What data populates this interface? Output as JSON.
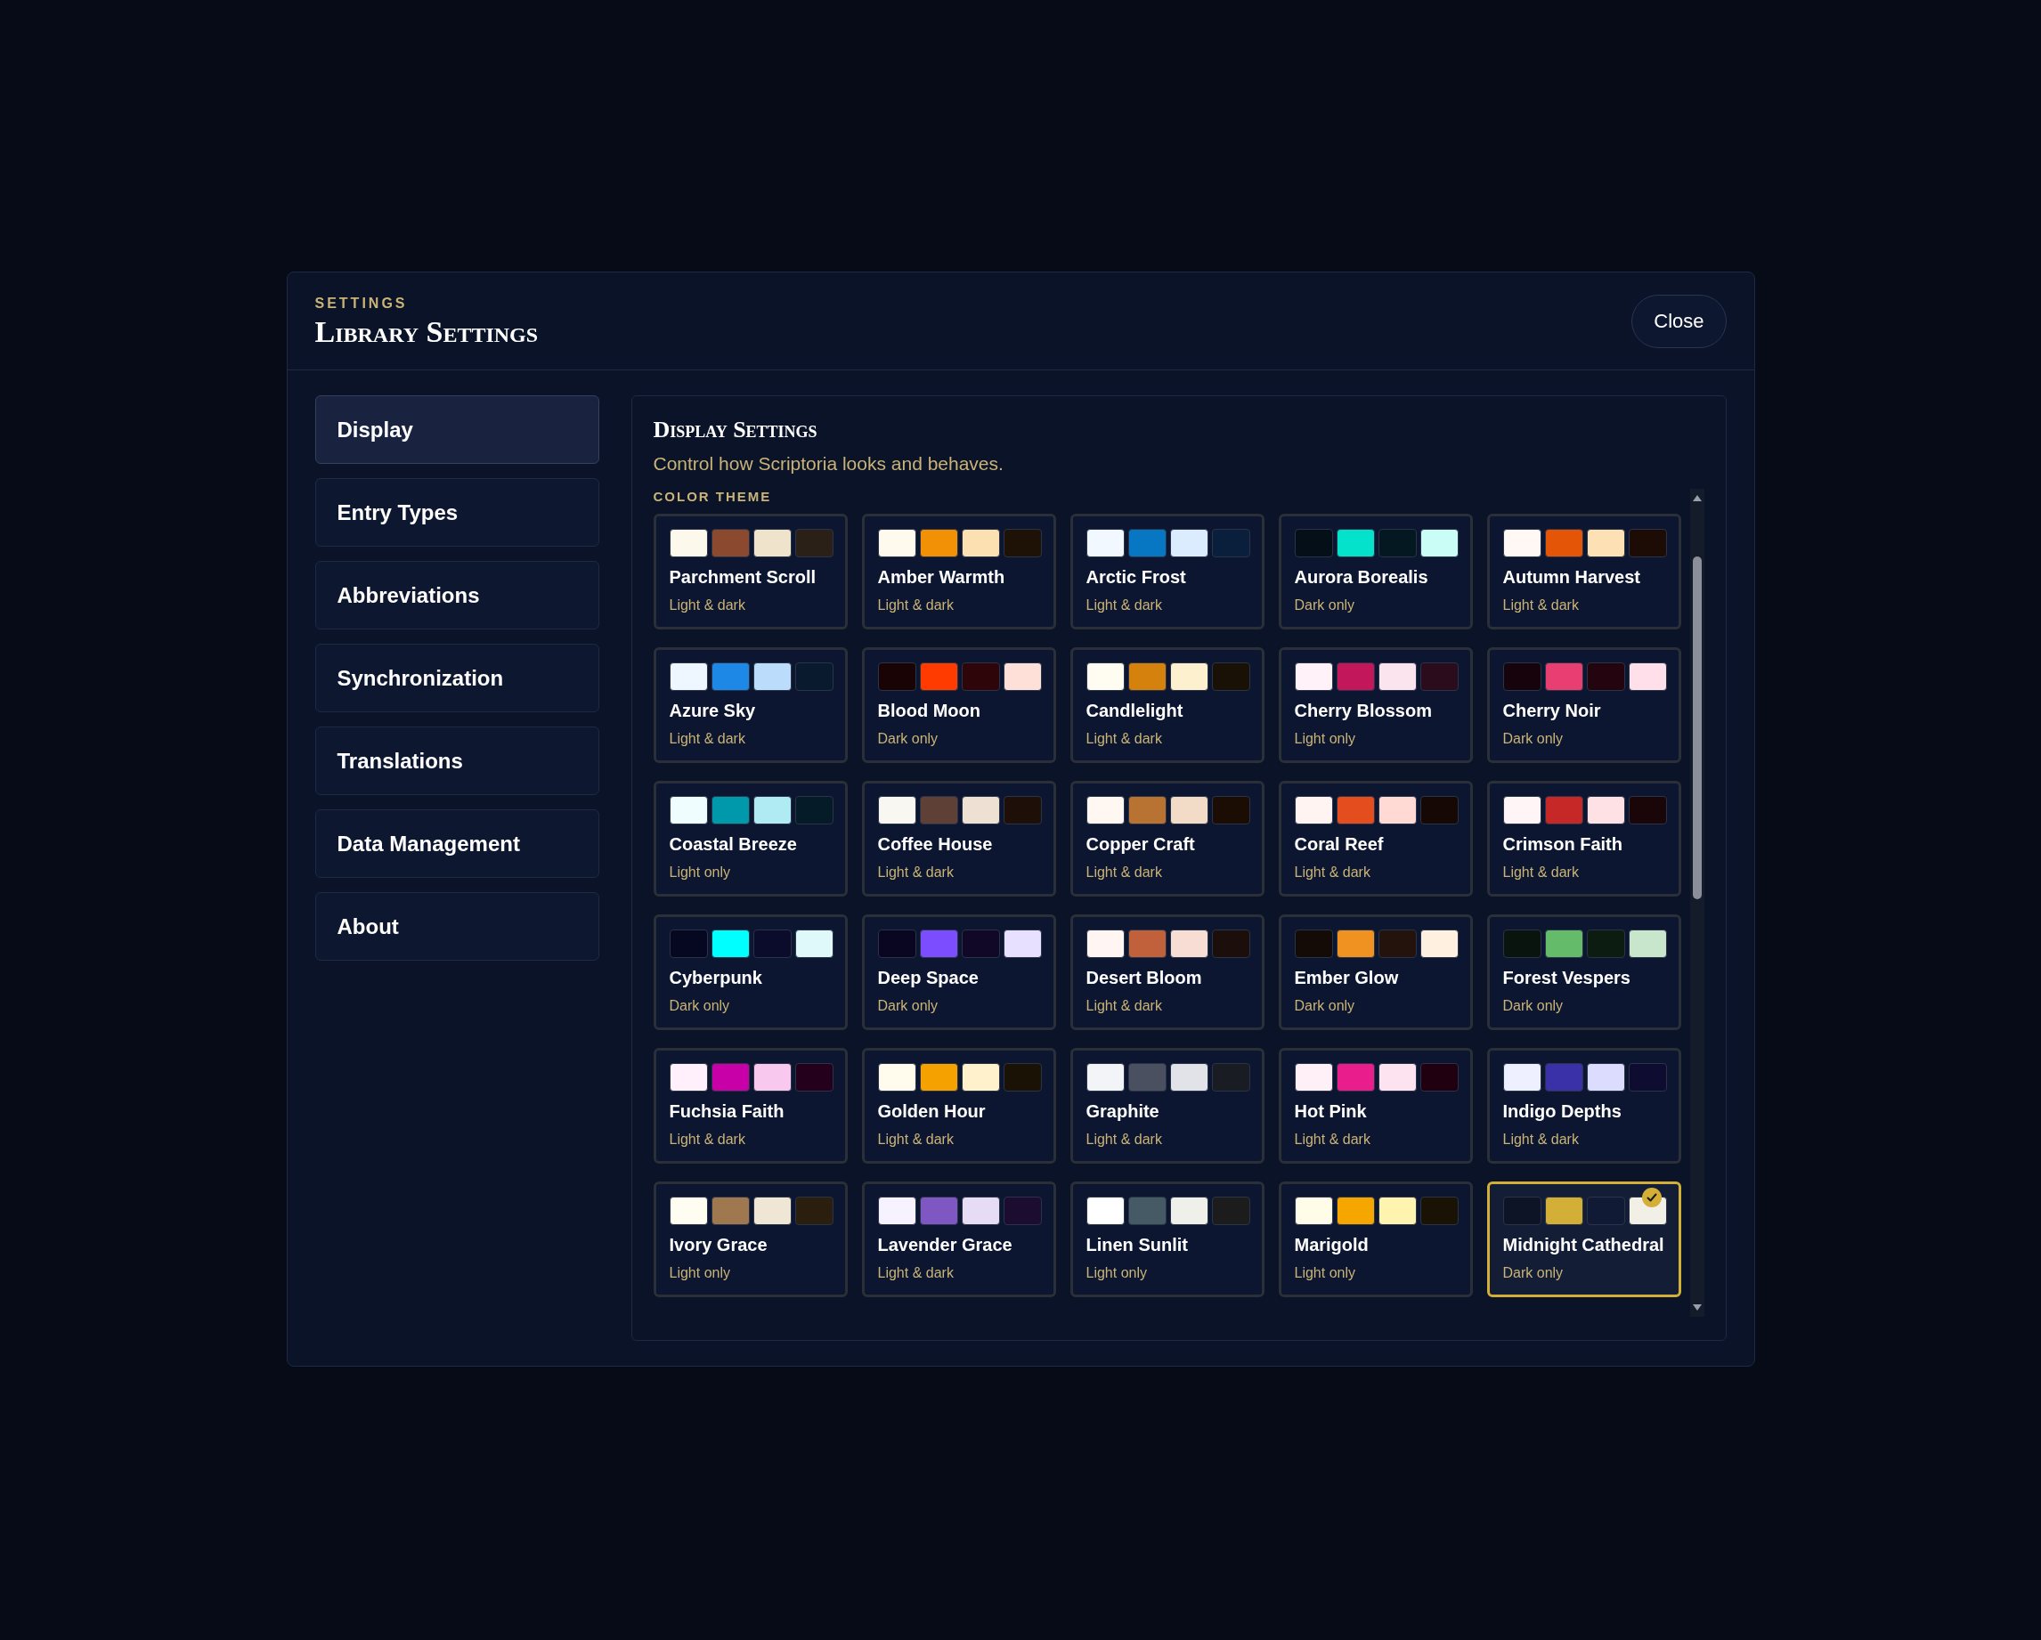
{
  "dialog": {
    "eyebrow": "SETTINGS",
    "title": "Library Settings",
    "close_label": "Close"
  },
  "sidebar": {
    "items": [
      {
        "label": "Display",
        "selected": true
      },
      {
        "label": "Entry Types",
        "selected": false
      },
      {
        "label": "Abbreviations",
        "selected": false
      },
      {
        "label": "Synchronization",
        "selected": false
      },
      {
        "label": "Translations",
        "selected": false
      },
      {
        "label": "Data Management",
        "selected": false
      },
      {
        "label": "About",
        "selected": false
      }
    ]
  },
  "panel": {
    "title": "Display Settings",
    "subtitle": "Control how Scriptoria looks and behaves.",
    "section_label": "COLOR THEME"
  },
  "themes": [
    {
      "name": "Parchment Scroll",
      "mode": "Light & dark",
      "selected": false,
      "swatches": [
        {
          "color": "#fdf8ec"
        },
        {
          "color": "#8b4a30"
        },
        {
          "color": "#f0e3cc"
        },
        {
          "color": "#2a2018"
        }
      ]
    },
    {
      "name": "Amber Warmth",
      "mode": "Light & dark",
      "selected": false,
      "swatches": [
        {
          "color": "#fffaee"
        },
        {
          "color": "#f29105"
        },
        {
          "color": "#fde0b2"
        },
        {
          "color": "#1e1206"
        }
      ]
    },
    {
      "name": "Arctic Frost",
      "mode": "Light & dark",
      "selected": false,
      "swatches": [
        {
          "color": "#f2f8ff"
        },
        {
          "color": "#0777c4"
        },
        {
          "color": "#dcecff"
        },
        {
          "color": "#0a1f3c"
        }
      ]
    },
    {
      "name": "Aurora Borealis",
      "mode": "Dark only",
      "selected": false,
      "swatches": [
        {
          "color": "#040f18"
        },
        {
          "color": "#05e2cb"
        },
        {
          "color": "#041822"
        },
        {
          "color": "#c9fdf5"
        }
      ]
    },
    {
      "name": "Autumn Harvest",
      "mode": "Light & dark",
      "selected": false,
      "swatches": [
        {
          "color": "#fff8f4"
        },
        {
          "color": "#e45508"
        },
        {
          "color": "#fde0b4"
        },
        {
          "color": "#1d0c06"
        }
      ]
    },
    {
      "name": "Azure Sky",
      "mode": "Light & dark",
      "selected": false,
      "swatches": [
        {
          "color": "#eef6ff"
        },
        {
          "color": "#1d88e5"
        },
        {
          "color": "#bcdcfb"
        },
        {
          "color": "#0a1a2e"
        }
      ]
    },
    {
      "name": "Blood Moon",
      "mode": "Dark only",
      "selected": false,
      "swatches": [
        {
          "color": "#1a0305"
        },
        {
          "color": "#ff3b00"
        },
        {
          "color": "#2e0508"
        },
        {
          "color": "#ffe0d9"
        }
      ]
    },
    {
      "name": "Candlelight",
      "mode": "Light & dark",
      "selected": false,
      "swatches": [
        {
          "color": "#fffdf2"
        },
        {
          "color": "#d4820d"
        },
        {
          "color": "#fdf0cf"
        },
        {
          "color": "#1a1106"
        }
      ]
    },
    {
      "name": "Cherry Blossom",
      "mode": "Light only",
      "selected": false,
      "swatches": [
        {
          "color": "#fff2f8"
        },
        {
          "color": "#c2185b"
        },
        {
          "color": "#fce4ee"
        },
        {
          "color": "#2a0c1c"
        }
      ]
    },
    {
      "name": "Cherry Noir",
      "mode": "Dark only",
      "selected": false,
      "swatches": [
        {
          "color": "#16030c"
        },
        {
          "color": "#e83e72"
        },
        {
          "color": "#24040f"
        },
        {
          "color": "#ffdfe9"
        }
      ]
    },
    {
      "name": "Coastal Breeze",
      "mode": "Light only",
      "selected": false,
      "swatches": [
        {
          "color": "#effdff"
        },
        {
          "color": "#0098ab"
        },
        {
          "color": "#b0ebf3"
        },
        {
          "color": "#051b28"
        }
      ]
    },
    {
      "name": "Coffee House",
      "mode": "Light & dark",
      "selected": false,
      "swatches": [
        {
          "color": "#f8f7f2"
        },
        {
          "color": "#5e4037"
        },
        {
          "color": "#eee0d3"
        },
        {
          "color": "#1e0f08"
        }
      ]
    },
    {
      "name": "Copper Craft",
      "mode": "Light & dark",
      "selected": false,
      "swatches": [
        {
          "color": "#fff7f2"
        },
        {
          "color": "#b87333"
        },
        {
          "color": "#f2dcc7"
        },
        {
          "color": "#1c0d04"
        }
      ]
    },
    {
      "name": "Coral Reef",
      "mode": "Light & dark",
      "selected": false,
      "swatches": [
        {
          "color": "#fff4f2"
        },
        {
          "color": "#e44d1d"
        },
        {
          "color": "#ffdad4"
        },
        {
          "color": "#160804"
        }
      ]
    },
    {
      "name": "Crimson Faith",
      "mode": "Light & dark",
      "selected": false,
      "swatches": [
        {
          "color": "#fff4f6"
        },
        {
          "color": "#c62828"
        },
        {
          "color": "#fde1e5"
        },
        {
          "color": "#1a0508"
        }
      ]
    },
    {
      "name": "Cyberpunk",
      "mode": "Dark only",
      "selected": false,
      "swatches": [
        {
          "color": "#060720"
        },
        {
          "color": "#00ffff"
        },
        {
          "color": "#0b0b2c"
        },
        {
          "color": "#dff8fa"
        }
      ]
    },
    {
      "name": "Deep Space",
      "mode": "Dark only",
      "selected": false,
      "swatches": [
        {
          "color": "#0a0520"
        },
        {
          "color": "#7c4dff"
        },
        {
          "color": "#100826"
        },
        {
          "color": "#e8e0ff"
        }
      ]
    },
    {
      "name": "Desert Bloom",
      "mode": "Light & dark",
      "selected": false,
      "swatches": [
        {
          "color": "#fff5f2"
        },
        {
          "color": "#c0613b"
        },
        {
          "color": "#f8ddd4"
        },
        {
          "color": "#1c0e0a"
        }
      ]
    },
    {
      "name": "Ember Glow",
      "mode": "Dark only",
      "selected": false,
      "swatches": [
        {
          "color": "#140a06"
        },
        {
          "color": "#ef9222"
        },
        {
          "color": "#24120c"
        },
        {
          "color": "#fff0e0"
        }
      ]
    },
    {
      "name": "Forest Vespers",
      "mode": "Dark only",
      "selected": false,
      "swatches": [
        {
          "color": "#0a140e"
        },
        {
          "color": "#64bb6a"
        },
        {
          "color": "#0c1c10"
        },
        {
          "color": "#c8e6cb"
        }
      ]
    },
    {
      "name": "Fuchsia Faith",
      "mode": "Light & dark",
      "selected": false,
      "swatches": [
        {
          "color": "#fff0fb"
        },
        {
          "color": "#c800a8"
        },
        {
          "color": "#f8c8ee"
        },
        {
          "color": "#24001c"
        }
      ]
    },
    {
      "name": "Golden Hour",
      "mode": "Light & dark",
      "selected": false,
      "swatches": [
        {
          "color": "#fffcee"
        },
        {
          "color": "#f5a200"
        },
        {
          "color": "#fff1cc"
        },
        {
          "color": "#1a1204"
        }
      ]
    },
    {
      "name": "Graphite",
      "mode": "Light & dark",
      "selected": false,
      "swatches": [
        {
          "color": "#f3f4f7"
        },
        {
          "color": "#4b5060"
        },
        {
          "color": "#e1e3e9"
        },
        {
          "color": "#1a1c24"
        }
      ]
    },
    {
      "name": "Hot Pink",
      "mode": "Light & dark",
      "selected": false,
      "swatches": [
        {
          "color": "#fff0f8"
        },
        {
          "color": "#e91e8c"
        },
        {
          "color": "#fde2ef"
        },
        {
          "color": "#200010"
        }
      ]
    },
    {
      "name": "Indigo Depths",
      "mode": "Light & dark",
      "selected": false,
      "swatches": [
        {
          "color": "#eef0ff"
        },
        {
          "color": "#3a30a8"
        },
        {
          "color": "#dcdcff"
        },
        {
          "color": "#0e0c30"
        }
      ]
    },
    {
      "name": "Ivory Grace",
      "mode": "Light only",
      "selected": false,
      "swatches": [
        {
          "color": "#fffcf2"
        },
        {
          "color": "#a07850"
        },
        {
          "color": "#f0e6d6"
        },
        {
          "color": "#2a1e0e"
        }
      ]
    },
    {
      "name": "Lavender Grace",
      "mode": "Light & dark",
      "selected": false,
      "swatches": [
        {
          "color": "#f6f2ff"
        },
        {
          "color": "#7e57c2"
        },
        {
          "color": "#e7dcf6"
        },
        {
          "color": "#1c0c30"
        }
      ]
    },
    {
      "name": "Linen Sunlit",
      "mode": "Light only",
      "selected": false,
      "swatches": [
        {
          "color": "#ffffff"
        },
        {
          "color": "#455a64"
        },
        {
          "color": "#f0f0eb"
        },
        {
          "color": "#1c1c1c"
        }
      ]
    },
    {
      "name": "Marigold",
      "mode": "Light only",
      "selected": false,
      "swatches": [
        {
          "color": "#fffce8"
        },
        {
          "color": "#f5a700"
        },
        {
          "color": "#fff3b0"
        },
        {
          "color": "#1a1204"
        }
      ]
    },
    {
      "name": "Midnight Cathedral",
      "mode": "Dark only",
      "selected": true,
      "swatches": [
        {
          "color": "#0c1426"
        },
        {
          "color": "#d4af37"
        },
        {
          "color": "#101a34"
        },
        {
          "color": "#f2efe6"
        }
      ]
    }
  ]
}
